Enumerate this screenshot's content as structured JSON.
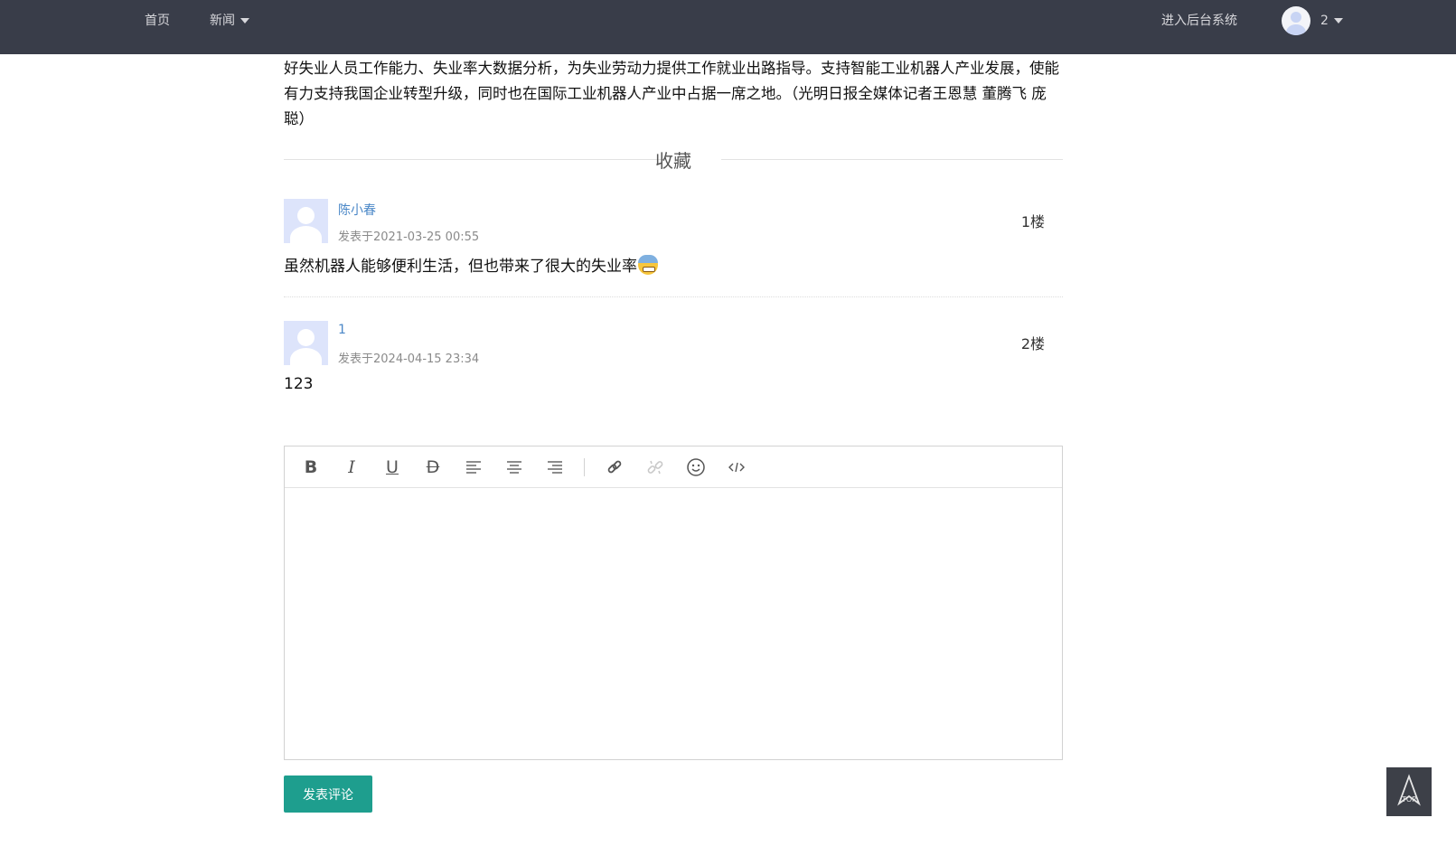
{
  "nav": {
    "home": "首页",
    "news": "新闻",
    "admin": "进入后台系统",
    "user": "2"
  },
  "article": {
    "tail": "好失业人员工作能力、失业率大数据分析，为失业劳动力提供工作就业出路指导。支持智能工业机器人产业发展，使能有力支持我国企业转型升级，同时也在国际工业机器人产业中占据一席之地。（光明日报全媒体记者王恩慧 董腾飞 庞聪）"
  },
  "favorite_label": "收藏",
  "comments": [
    {
      "author": "陈小春",
      "time": "发表于2021-03-25 00:55",
      "floor": "1楼",
      "text": "虽然机器人能够便利生活，但也带来了很大的失业率",
      "emoji": "grimacing-emoji"
    },
    {
      "author": "1",
      "time": "发表于2024-04-15 23:34",
      "floor": "2楼",
      "text": "123"
    }
  ],
  "editor": {
    "tools": [
      "bold-icon",
      "italic-icon",
      "underline-icon",
      "strikethrough-icon",
      "align-left-icon",
      "align-center-icon",
      "align-right-icon",
      "link-icon",
      "unlink-icon",
      "emoji-icon",
      "code-icon"
    ],
    "content": ""
  },
  "submit_label": "发表评论",
  "back_to_top": "TOP",
  "colors": {
    "nav_bg": "#393d49",
    "accent": "#1e9e8e",
    "author_link": "#4a87c7"
  }
}
